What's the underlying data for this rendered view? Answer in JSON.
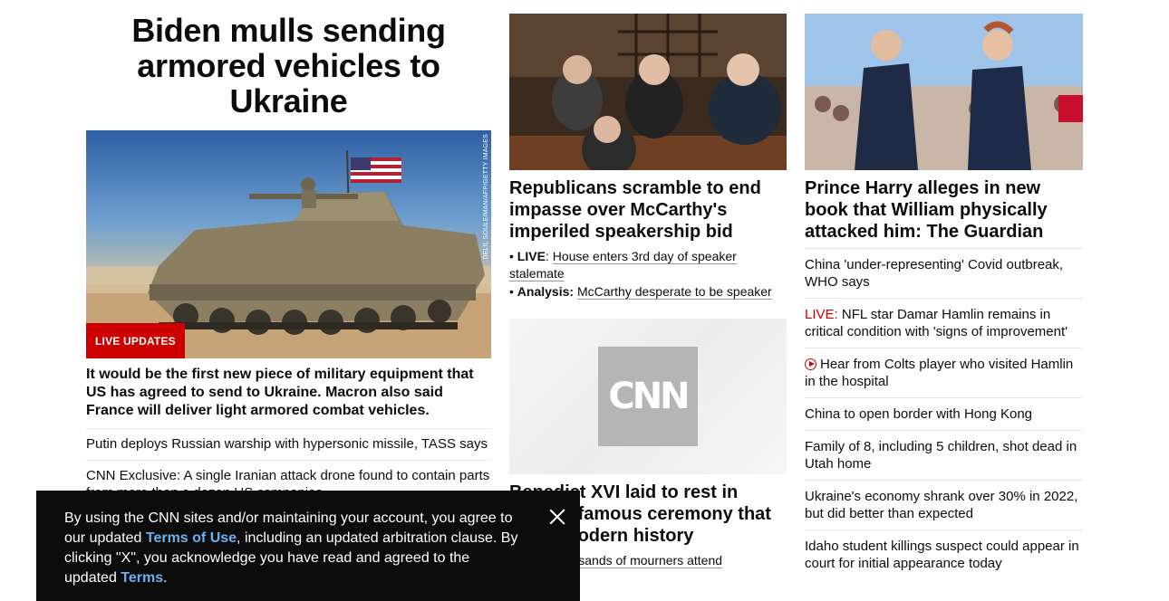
{
  "lead": {
    "headline": "Biden mulls sending armored vehicles to Ukraine",
    "image_credit": "DELIL SOULEIMAN/AFP/GETTY IMAGES",
    "badge": "LIVE UPDATES",
    "description": "It would be the first new piece of military equipment that US has agreed to send to Ukraine. Macron also said France will deliver light armored combat vehicles.",
    "stories": [
      "Putin deploys Russian warship with hypersonic missile, TASS says",
      "CNN Exclusive: A single Iranian attack drone found to contain parts from more than a dozen US companies"
    ]
  },
  "middle": {
    "headline": "Republicans scramble to end impasse over McCarthy's imperiled speakership bid",
    "bullets": [
      {
        "label": "LIVE",
        "sep": ": ",
        "text": "House enters 3rd day of speaker stalemate"
      },
      {
        "label": "Analysis:",
        "sep": " ",
        "text": "McCarthy desperate to be speaker"
      }
    ],
    "cnn_logo": "CNN",
    "headline2": "Benedict XVI laid to rest in solemn famous ceremony that made modern history",
    "sub2": "Tens of thousands of mourners attend"
  },
  "right": {
    "headline": "Prince Harry alleges in new book that William physically attacked him: The Guardian",
    "stories": [
      {
        "prefix": "",
        "text": "China 'under-representing' Covid outbreak, WHO says"
      },
      {
        "prefix": "LIVE:",
        "text": " NFL star Damar Hamlin remains in critical condition with 'signs of improvement'"
      },
      {
        "prefix": "",
        "text": "Hear from Colts player who visited Hamlin in the hospital",
        "icon": "play-icon"
      },
      {
        "prefix": "",
        "text": "China to open border with Hong Kong"
      },
      {
        "prefix": "",
        "text": "Family of 8, including 5 children, shot dead in Utah home"
      },
      {
        "prefix": "",
        "text": "Ukraine's economy shrank over 30% in 2022, but did better than expected"
      },
      {
        "prefix": "",
        "text": "Idaho student killings suspect could appear in court for initial appearance today"
      }
    ]
  },
  "consent": {
    "text1": "By using the CNN sites and/or maintaining your account, you agree to our updated ",
    "link1": "Terms of Use",
    "text2": ", including an updated arbitration clause. By clicking \"X\", you acknowledge you have read and agreed to the updated ",
    "link2": "Terms",
    "text3": "."
  },
  "colors": {
    "brand_red": "#cc0000",
    "link_blue": "#6ab0f0",
    "banner_bg": "#0c0c0c"
  }
}
